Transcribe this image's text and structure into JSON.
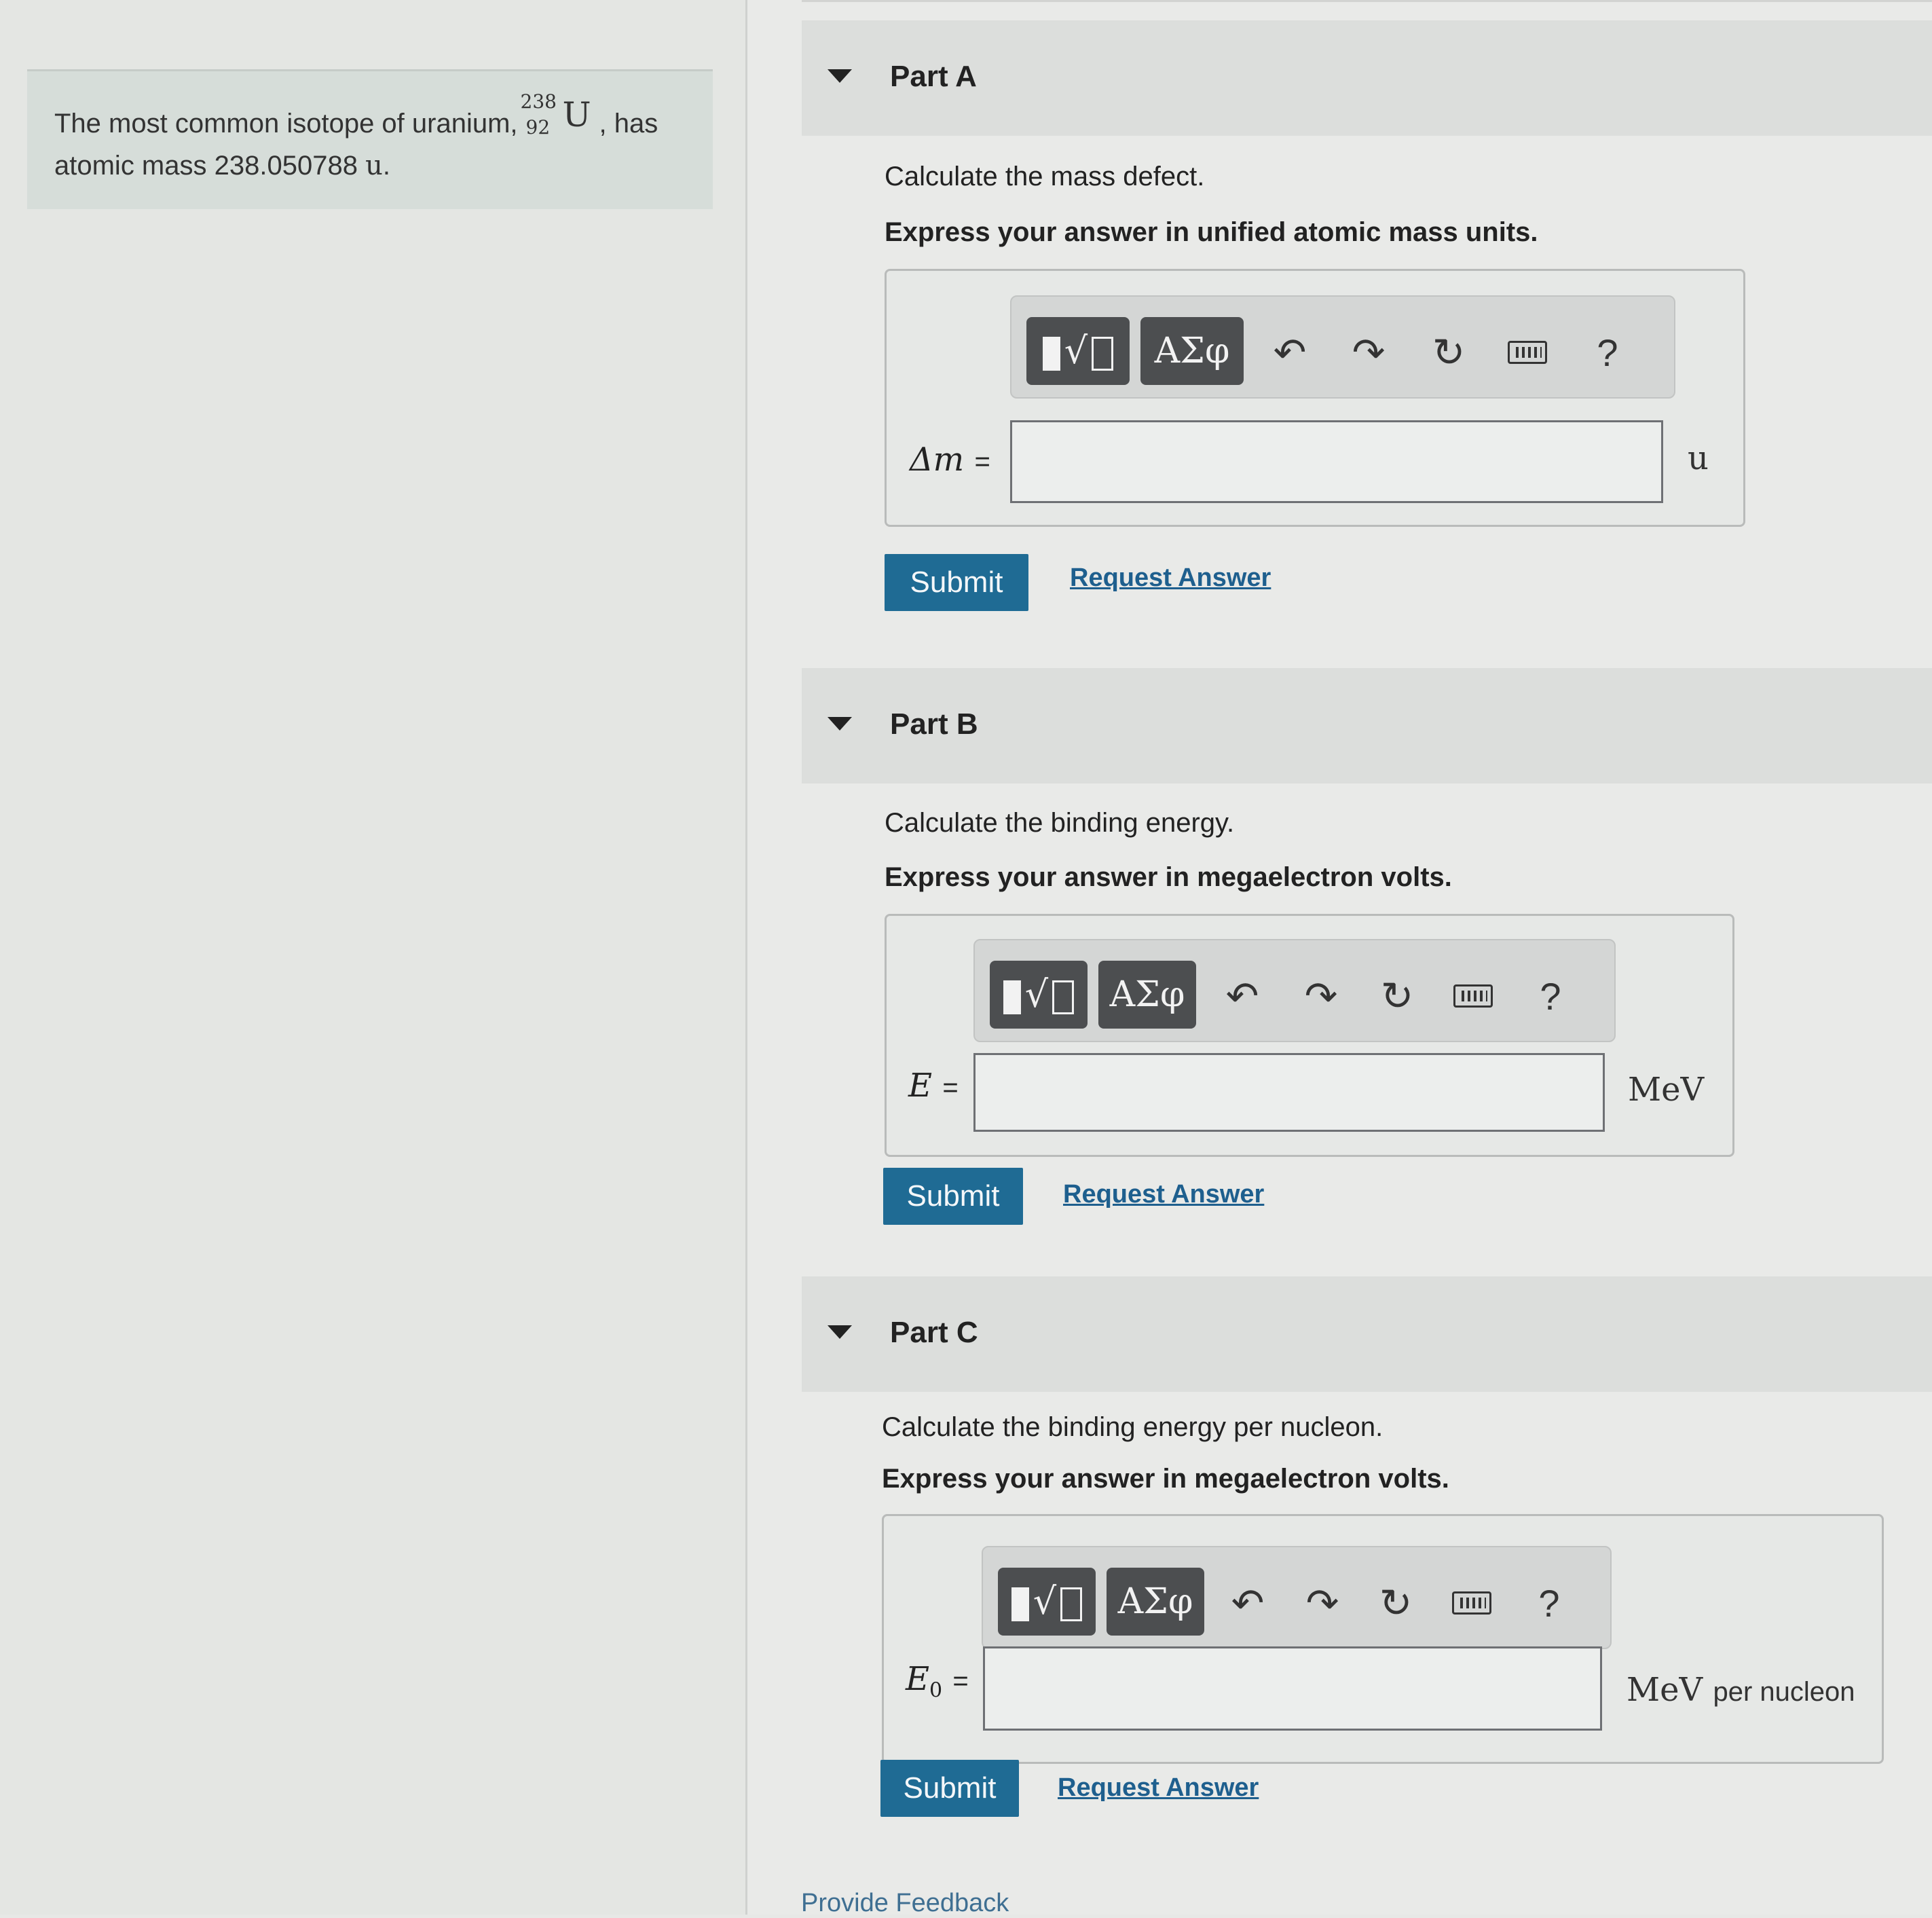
{
  "problem": {
    "text_before": "The most common isotope of uranium,",
    "isotope": {
      "mass_number": "238",
      "atomic_number": "92",
      "symbol": "U"
    },
    "text_after_isotope": ", has",
    "line2": "atomic mass 238.050788",
    "unit": "u",
    "end": "."
  },
  "toolbar": {
    "template_icon": "fraction-radical-template-icon",
    "greek_label": "ΑΣφ",
    "undo_glyph": "↶",
    "redo_glyph": "↷",
    "reset_glyph": "↻",
    "keyboard_icon": "keyboard-icon",
    "help_label": "?"
  },
  "parts": [
    {
      "title": "Part A",
      "prompt": "Calculate the mass defect.",
      "instruction": "Express your answer in unified atomic mass units.",
      "variable": "Δm",
      "variable_sub": "",
      "equals": "=",
      "input_value": "",
      "unit": "u",
      "unit_suffix": "",
      "submit_label": "Submit",
      "request_label": "Request Answer"
    },
    {
      "title": "Part B",
      "prompt": "Calculate the binding energy.",
      "instruction": "Express your answer in megaelectron volts.",
      "variable": "E",
      "variable_sub": "",
      "equals": "=",
      "input_value": "",
      "unit": "MeV",
      "unit_suffix": "",
      "submit_label": "Submit",
      "request_label": "Request Answer"
    },
    {
      "title": "Part C",
      "prompt": "Calculate the binding energy per nucleon.",
      "instruction": "Express your answer in megaelectron volts.",
      "variable": "E",
      "variable_sub": "0",
      "equals": "=",
      "input_value": "",
      "unit": "MeV",
      "unit_suffix": "per nucleon",
      "submit_label": "Submit",
      "request_label": "Request Answer"
    }
  ],
  "footer": {
    "feedback_link": "Provide Feedback"
  },
  "colors": {
    "submit": "#1f6b94",
    "link": "#1e5f8e",
    "toolbar_dark": "#4c4e50"
  }
}
